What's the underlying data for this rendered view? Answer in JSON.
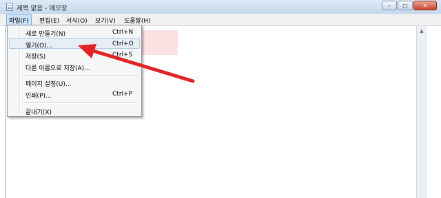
{
  "window": {
    "title": "제목 없음 - 메모장"
  },
  "controls": {
    "minimize": "–",
    "maximize": "□",
    "close": "✕"
  },
  "menubar": {
    "items": [
      {
        "label": "파일(F)"
      },
      {
        "label": "편집(E)"
      },
      {
        "label": "서식(O)"
      },
      {
        "label": "보기(V)"
      },
      {
        "label": "도움말(H)"
      }
    ]
  },
  "file_menu": {
    "items": [
      {
        "label": "새로 만들기(N)",
        "shortcut": "Ctrl+N"
      },
      {
        "label": "열기(O)...",
        "shortcut": "Ctrl+O"
      },
      {
        "label": "저장(S)",
        "shortcut": "Ctrl+S"
      },
      {
        "label": "다른 이름으로 저장(A)...",
        "shortcut": ""
      },
      {
        "label": "페이지 설정(U)...",
        "shortcut": ""
      },
      {
        "label": "인쇄(P)...",
        "shortcut": "Ctrl+P"
      },
      {
        "label": "끝내기(X)",
        "shortcut": ""
      }
    ]
  },
  "colors": {
    "annotation_arrow": "#e02424",
    "menu_highlight": "#cce3f8",
    "highlight_box": "#fbe3e3"
  },
  "icons": {
    "scroll_up": "▲"
  }
}
